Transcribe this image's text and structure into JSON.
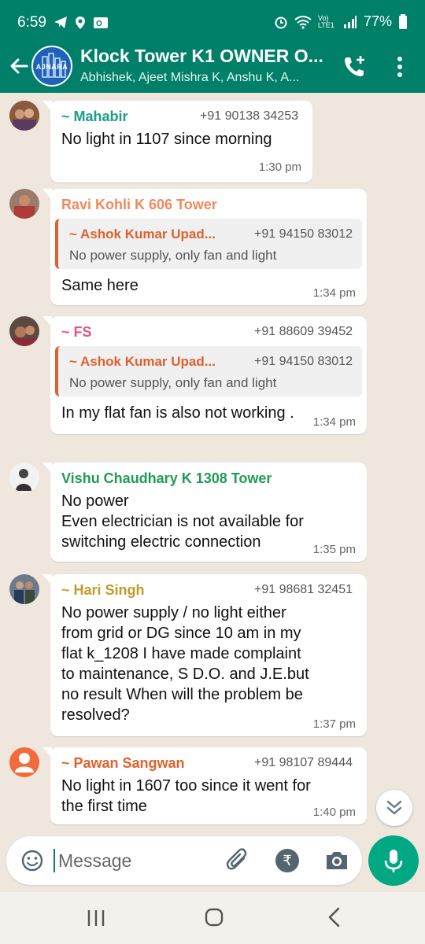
{
  "status_bar": {
    "time": "6:59",
    "battery": "77%",
    "network_label": "Vo) LTE1"
  },
  "header": {
    "title": "Klock Tower K1 OWNER O...",
    "subtitle": "Abhishek, Ajeet Mishra K, Anshu K, A...",
    "group_logo_text": "AJNARA"
  },
  "messages": [
    {
      "sender": "~ Mahabir",
      "sender_color": "#1a9e8a",
      "phone": "+91 90138 34253",
      "text": "No light in 1107 since morning",
      "time": "1:30 pm"
    },
    {
      "sender": "Ravi Kohli K 606 Tower",
      "sender_color": "#f08a5d",
      "phone": "",
      "quote": {
        "name": "~ Ashok Kumar Upad...",
        "phone": "+91 94150 83012",
        "text": "No power supply, only fan and light"
      },
      "text": "Same here",
      "time": "1:34 pm"
    },
    {
      "sender": "~ FS",
      "sender_color": "#e0558a",
      "phone": "+91 88609 39452",
      "quote": {
        "name": "~ Ashok Kumar Upad...",
        "phone": "+91 94150 83012",
        "text": "No power supply, only fan and light"
      },
      "text": "In my flat fan is also not working .",
      "time": "1:34 pm"
    },
    {
      "sender": "Vishu Chaudhary K 1308 Tower",
      "sender_color": "#1f9b55",
      "phone": "",
      "text_lines": [
        "No power",
        "Even electrician is not available for",
        "switching electric connection"
      ],
      "time": "1:35 pm"
    },
    {
      "sender": "~ Hari Singh",
      "sender_color": "#c29a2a",
      "phone": "+91 98681 32451",
      "text_lines": [
        "No power supply / no light either",
        "from grid or DG since 10 am in my",
        "flat k_1208  I have made complaint",
        "to maintenance, S D.O. and J.E.but",
        "no result When will the problem be",
        "resolved?"
      ],
      "time": "1:37 pm"
    },
    {
      "sender": "~ Pawan Sangwan",
      "sender_color": "#e0602e",
      "phone": "+91 98107 89444",
      "text_lines": [
        "No light in 1607 too since it went for",
        "the first time"
      ],
      "time": "1:40 pm"
    }
  ],
  "input": {
    "placeholder": "Message"
  },
  "colors": {
    "header_green": "#008069",
    "accent_green": "#00a884",
    "chat_background": "#efe7de"
  }
}
